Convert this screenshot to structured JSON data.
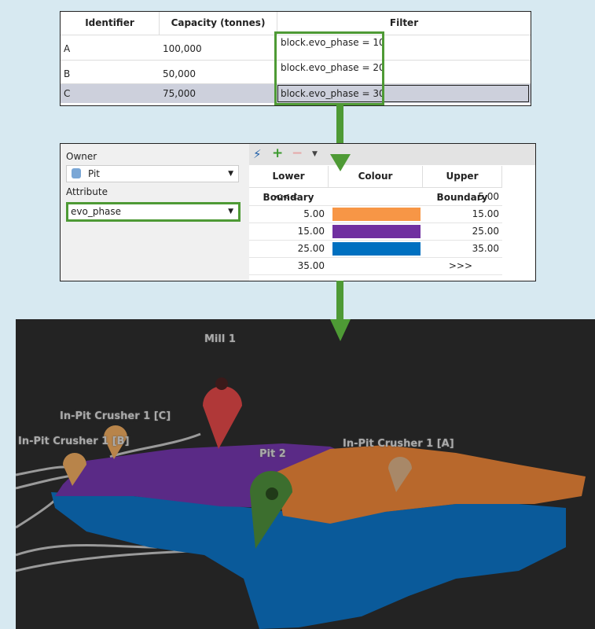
{
  "filter_table": {
    "headers": [
      "Identifier",
      "Capacity (tonnes)",
      "Filter"
    ],
    "rows": [
      {
        "id": "A",
        "capacity": "100,000",
        "filter": "block.evo_phase = 10"
      },
      {
        "id": "B",
        "capacity": "50,000",
        "filter": "block.evo_phase = 20"
      },
      {
        "id": "C",
        "capacity": "75,000",
        "filter": "block.evo_phase = 30"
      }
    ]
  },
  "legend_panel": {
    "owner_label": "Owner",
    "owner_value": "Pit",
    "attribute_label": "Attribute",
    "attribute_value": "evo_phase",
    "headers": [
      "Lower Boundary",
      "Colour",
      "Upper Boundary"
    ],
    "rows": [
      {
        "lower": "<<<",
        "color": "",
        "upper": "5.00"
      },
      {
        "lower": "5.00",
        "color": "#f79646",
        "upper": "15.00"
      },
      {
        "lower": "15.00",
        "color": "#7030a0",
        "upper": "25.00"
      },
      {
        "lower": "25.00",
        "color": "#0070c0",
        "upper": "35.00"
      },
      {
        "lower": "35.00",
        "color": "",
        "upper": ">>>"
      }
    ],
    "icons": [
      "auto-lightning-icon",
      "add-icon",
      "remove-icon",
      "dropdown-icon"
    ]
  },
  "scene": {
    "labels": [
      "Mill 1",
      "In-Pit Crusher 1 [C]",
      "In-Pit Crusher 1 [B]",
      "Pit 2",
      "In-Pit Crusher 1 [A]"
    ]
  },
  "colors": {
    "highlight": "#4e9a35",
    "orange": "#f79646",
    "purple": "#7030a0",
    "blue": "#0070c0"
  }
}
